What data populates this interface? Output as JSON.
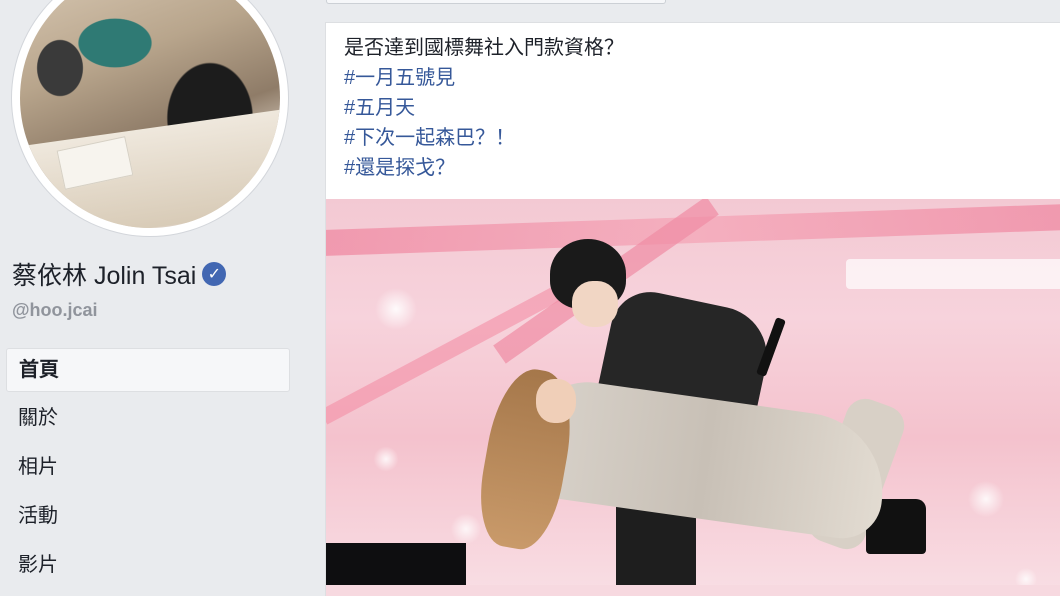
{
  "profile": {
    "name": "蔡依林 Jolin Tsai",
    "verified_icon": "check-icon",
    "verified_glyph": "✓",
    "handle": "@hoo.jcai"
  },
  "nav": {
    "items": [
      {
        "label": "首頁",
        "active": true
      },
      {
        "label": "關於",
        "active": false
      },
      {
        "label": "相片",
        "active": false
      },
      {
        "label": "活動",
        "active": false
      },
      {
        "label": "影片",
        "active": false
      }
    ]
  },
  "post": {
    "lines": [
      {
        "text": "是否達到國標舞社入門款資格？",
        "hashtag": false
      },
      {
        "text": "#一月五號見",
        "hashtag": true
      },
      {
        "text": "#五月天",
        "hashtag": true
      },
      {
        "text": "#下次一起森巴？！",
        "hashtag": true
      },
      {
        "text": "#還是探戈？",
        "hashtag": true
      }
    ]
  },
  "colors": {
    "background": "#e9ebee",
    "link": "#365899",
    "verified": "#4267b2"
  }
}
